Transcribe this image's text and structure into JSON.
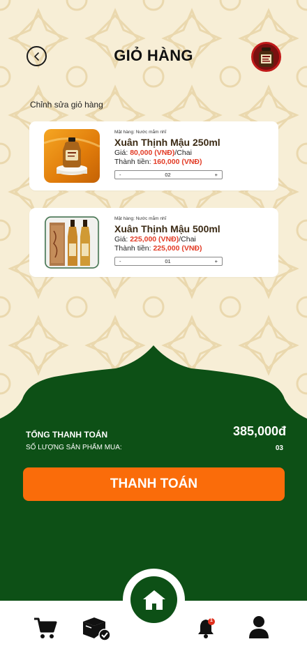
{
  "header": {
    "title": "GIỎ HÀNG"
  },
  "cart": {
    "edit_label": "Chỉnh sửa giỏ hàng",
    "items": [
      {
        "category": "Mặt hàng: Nước mắm nhĩ",
        "name": "Xuân Thịnh Mậu 250ml",
        "price_label": "Giá:",
        "price": "80,000 (VNĐ)",
        "unit": "/Chai",
        "subtotal_label": "Thành tiền:",
        "subtotal": "160,000 (VNĐ)",
        "qty_minus": "-",
        "qty": "02",
        "qty_plus": "+"
      },
      {
        "category": "Mặt hàng: Nước mắm nhĩ",
        "name": "Xuân Thịnh Mậu 500ml",
        "price_label": "Giá:",
        "price": "225,000 (VNĐ)",
        "unit": "/Chai",
        "subtotal_label": "Thành tiền:",
        "subtotal": "225,000 (VNĐ)",
        "qty_minus": "-",
        "qty": "01",
        "qty_plus": "+"
      }
    ]
  },
  "summary": {
    "total_label": "TỔNG THANH TOÁN",
    "total_value": "385,000đ",
    "count_label": "SỐ LƯỢNG SẢN PHẨM MUA:",
    "count_value": "03",
    "checkout_label": "THANH TOÁN"
  },
  "nav": {
    "icons": [
      "cart-icon",
      "box-check-icon",
      "home-icon",
      "bell-icon",
      "user-icon"
    ],
    "notification_badge": "1"
  },
  "colors": {
    "background": "#f7eed6",
    "panel_green": "#0d5016",
    "accent_orange": "#fa6c0a",
    "price_red": "#e23b25",
    "badge_red": "#e0301e"
  }
}
